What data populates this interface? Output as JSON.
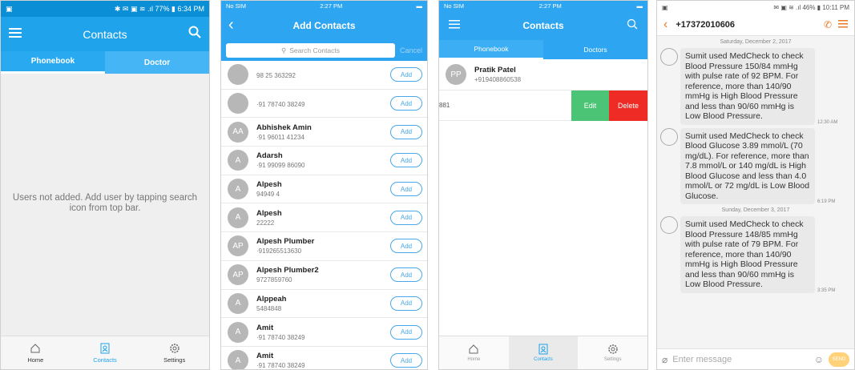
{
  "screen1": {
    "status": {
      "left": "",
      "right": "✱ ✉ ▣ ≋ .ıl 77% ▮ 6:34 PM"
    },
    "title": "Contacts",
    "tabs": [
      "Phonebook",
      "Doctor"
    ],
    "empty_message": "Users not added. Add user by tapping search icon from top bar.",
    "nav": [
      "Home",
      "Contacts",
      "Settings"
    ]
  },
  "screen2": {
    "status": {
      "carrier": "No SIM",
      "time": "2:27 PM"
    },
    "title": "Add Contacts",
    "search_placeholder": "Search Contacts",
    "cancel": "Cancel",
    "add_label": "Add",
    "contacts": [
      {
        "initials": "",
        "name": "",
        "phone": "98 25 363292"
      },
      {
        "initials": "",
        "name": "",
        "phone": "·91 78740 38249"
      },
      {
        "initials": "AA",
        "name": "Abhishek Amin",
        "phone": "·91 96011 41234"
      },
      {
        "initials": "A",
        "name": "Adarsh",
        "phone": "·91 99099 86090"
      },
      {
        "initials": "A",
        "name": "Alpesh",
        "phone": "94949 4"
      },
      {
        "initials": "A",
        "name": "Alpesh",
        "phone": "22222"
      },
      {
        "initials": "AP",
        "name": "Alpesh Plumber",
        "phone": "·919265513630"
      },
      {
        "initials": "AP",
        "name": "Alpesh Plumber2",
        "phone": "9727859760"
      },
      {
        "initials": "A",
        "name": "Alppeah",
        "phone": "5484848"
      },
      {
        "initials": "A",
        "name": "Amit",
        "phone": "·91 78740 38249"
      },
      {
        "initials": "A",
        "name": "Amit",
        "phone": "·91 78740 38249"
      }
    ]
  },
  "screen3": {
    "status": {
      "carrier": "No SIM",
      "time": "2:27 PM"
    },
    "title": "Contacts",
    "tabs": [
      "Phonebook",
      "Doctors"
    ],
    "contact": {
      "initials": "PP",
      "name": "Pratik Patel",
      "phone": "+919408860538"
    },
    "swiped_text": "881",
    "edit": "Edit",
    "delete": "Delete",
    "nav": [
      "Home",
      "Contacts",
      "Settings"
    ]
  },
  "screen4": {
    "status": {
      "right": "✉ ▣ ≋ .ıl 46% ▮ 10:11 PM"
    },
    "number": "+17372010606",
    "messages": [
      {
        "date": "Saturday, December 2, 2017",
        "text": "Sumit used MedCheck to check Blood Pressure 150/84 mmHg with pulse rate of 92 BPM. For reference, more than 140/90 mmHg is High Blood Pressure and less than 90/60 mmHg is Low Blood Pressure.",
        "time": "12:30 AM"
      },
      {
        "date": "",
        "text": "Sumit used MedCheck to check Blood Glucose 3.89 mmol/L (70 mg/dL). For reference, more than 7.8 mmol/L or 140 mg/dL is High Blood Glucose and less than 4.0 mmol/L or 72 mg/dL is Low Blood Glucose.",
        "time": "6:19 PM"
      },
      {
        "date": "Sunday, December 3, 2017",
        "text": "Sumit used MedCheck to check Blood Pressure 148/85 mmHg with pulse rate of 79 BPM. For reference, more than 140/90 mmHg is High Blood Pressure and less than 90/60 mmHg is Low Blood Pressure.",
        "time": "3:35 PM"
      }
    ],
    "placeholder": "Enter message",
    "send": "SEND"
  }
}
